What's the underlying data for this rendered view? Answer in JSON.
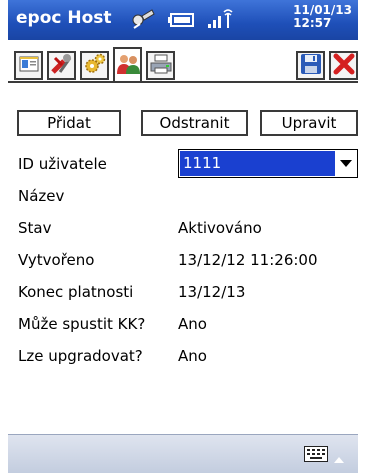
{
  "titlebar": {
    "app_title": "epoc Host",
    "clock_date": "11/01/13",
    "clock_time": "12:57"
  },
  "toolbar": {
    "tabs": [
      {
        "icon": "card-icon"
      },
      {
        "icon": "tools-icon"
      },
      {
        "icon": "gears-icon"
      },
      {
        "icon": "users-icon",
        "active": true
      },
      {
        "icon": "printer-icon"
      }
    ],
    "actions": [
      {
        "icon": "save-icon"
      },
      {
        "icon": "close-icon"
      }
    ]
  },
  "actions": {
    "add_label": "Přidat",
    "remove_label": "Odstranit",
    "edit_label": "Upravit"
  },
  "form": {
    "user_id_label": "ID uživatele",
    "user_id_value": "1111",
    "name_label": "Název",
    "status_label": "Stav",
    "status_value": "Aktivováno",
    "created_label": "Vytvořeno",
    "created_value": "13/12/12 11:26:00",
    "expiry_label": "Konec platnosti",
    "expiry_value": "13/12/13",
    "can_run_qc_label": "Může spustit KK?",
    "can_run_qc_value": "Ano",
    "can_upgrade_label": "Lze upgradovat?",
    "can_upgrade_value": "Ano"
  },
  "colors": {
    "titlebar": "#2a5cc8",
    "selection": "#1a40d0",
    "bottombar": "#d3dae8"
  }
}
